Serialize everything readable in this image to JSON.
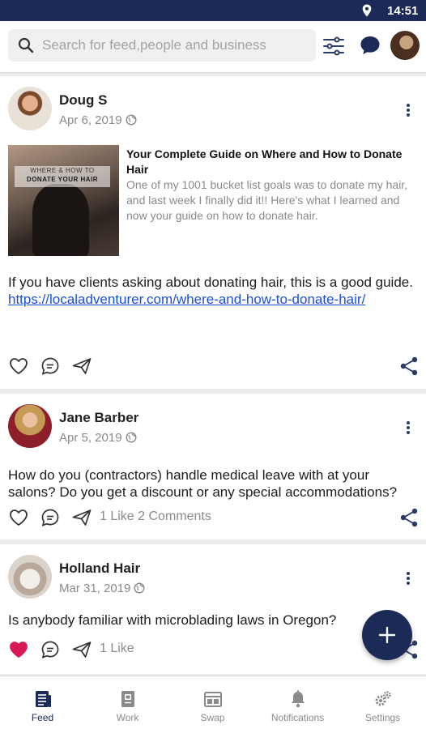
{
  "status_bar": {
    "time": "14:51",
    "icons": [
      "location-icon"
    ]
  },
  "header": {
    "search_placeholder": "Search for feed,people and business",
    "icons": [
      "search-icon",
      "filter-icon",
      "chat-icon",
      "profile-avatar"
    ]
  },
  "posts": [
    {
      "author": "Doug S",
      "date": "Apr 6, 2019",
      "link_preview": {
        "image_caption_line1": "WHERE & HOW TO",
        "image_caption_line2": "DONATE YOUR HAIR",
        "title": "Your Complete Guide on Where and How to Donate Hair",
        "description": "One of my 1001 bucket list goals was to donate my hair, and last week I finally did it!! Here's what I learned and now your guide on how to donate hair."
      },
      "text": "If you have clients asking about donating hair, this is a good guide.",
      "link": "https://localadventurer.com/where-and-how-to-donate-hair/",
      "liked": false,
      "stats": ""
    },
    {
      "author": "Jane Barber",
      "date": "Apr 5, 2019",
      "text": "How do you (contractors) handle medical leave with at your salons? Do you get a discount or any special accommodations?",
      "liked": false,
      "stats": "1 Like 2 Comments"
    },
    {
      "author": "Holland Hair",
      "date": "Mar 31, 2019",
      "text": "Is anybody familiar with microblading laws in Oregon?",
      "liked": true,
      "stats": "1 Like"
    }
  ],
  "bottom_nav": [
    {
      "label": "Feed",
      "icon": "feed-icon",
      "active": true
    },
    {
      "label": "Work",
      "icon": "work-icon",
      "active": false
    },
    {
      "label": "Swap",
      "icon": "swap-icon",
      "active": false
    },
    {
      "label": "Notifications",
      "icon": "bell-icon",
      "active": false
    },
    {
      "label": "Settings",
      "icon": "settings-icon",
      "active": false
    }
  ],
  "colors": {
    "primary": "#1b2a56",
    "liked": "#d81b55",
    "link": "#1a4fd6",
    "muted": "#8a8a8a"
  }
}
